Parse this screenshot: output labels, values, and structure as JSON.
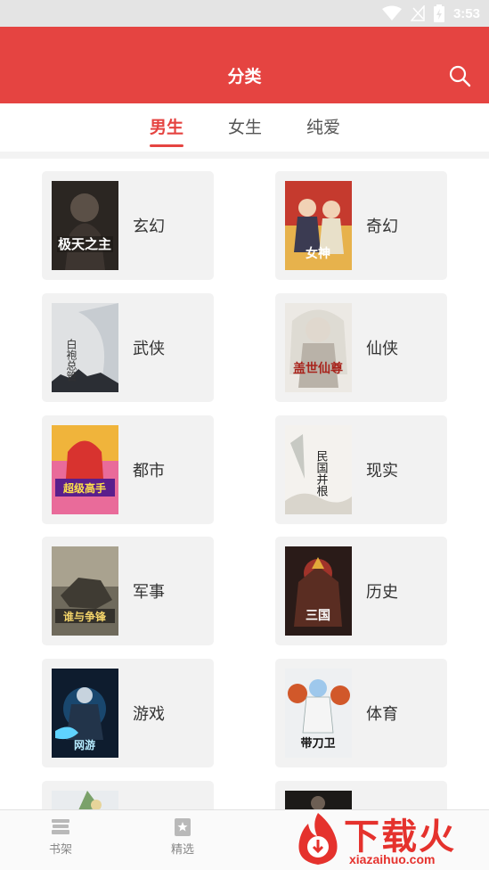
{
  "status_bar": {
    "time": "3:53"
  },
  "header": {
    "title": "分类"
  },
  "tabs": [
    {
      "label": "男生",
      "active": true
    },
    {
      "label": "女生",
      "active": false
    },
    {
      "label": "纯爱",
      "active": false
    }
  ],
  "categories": [
    {
      "label": "玄幻",
      "cover_text": "极天之主"
    },
    {
      "label": "奇幻",
      "cover_text": "女神"
    },
    {
      "label": "武侠",
      "cover_text": "白袍总管"
    },
    {
      "label": "仙侠",
      "cover_text": "盖世仙尊"
    },
    {
      "label": "都市",
      "cover_text": "超级高手"
    },
    {
      "label": "现实",
      "cover_text": "民国并根"
    },
    {
      "label": "军事",
      "cover_text": "谁与争锋"
    },
    {
      "label": "历史",
      "cover_text": "三国"
    },
    {
      "label": "游戏",
      "cover_text": "网游"
    },
    {
      "label": "体育",
      "cover_text": "带刀卫"
    }
  ],
  "bottom_nav": [
    {
      "label": "书架",
      "icon": "bookshelf-icon"
    },
    {
      "label": "精选",
      "icon": "star-icon"
    }
  ],
  "watermark": {
    "text": "下载火",
    "sub": "xiazaihuo.com"
  },
  "colors": {
    "accent": "#e54441",
    "card_bg": "#f2f2f2"
  }
}
